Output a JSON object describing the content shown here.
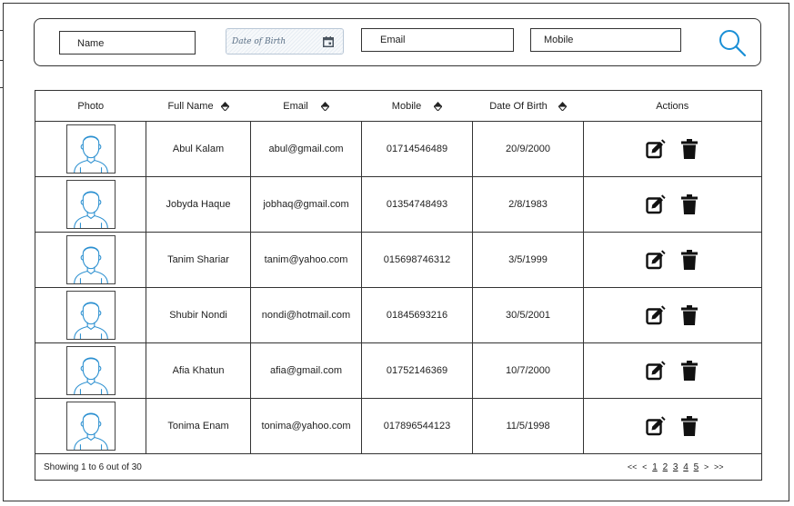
{
  "filters": {
    "name_label": "Name",
    "dob_label": "Date of Birth",
    "email_label": "Email",
    "mobile_label": "Mobile"
  },
  "table": {
    "headers": [
      "Photo",
      "Full Name",
      "Email",
      "Mobile",
      "Date Of Birth",
      "Actions"
    ],
    "rows": [
      {
        "name": "Abul Kalam",
        "email": "abul@gmail.com",
        "mobile": "01714546489",
        "dob": "20/9/2000"
      },
      {
        "name": "Jobyda Haque",
        "email": "jobhaq@gmail.com",
        "mobile": "01354748493",
        "dob": "2/8/1983"
      },
      {
        "name": "Tanim Shariar",
        "email": "tanim@yahoo.com",
        "mobile": "015698746312",
        "dob": "3/5/1999"
      },
      {
        "name": "Shubir Nondi",
        "email": "nondi@hotmail.com",
        "mobile": "01845693216",
        "dob": "30/5/2001"
      },
      {
        "name": "Afia Khatun",
        "email": "afia@gmail.com",
        "mobile": "01752146369",
        "dob": "10/7/2000"
      },
      {
        "name": "Tonima Enam",
        "email": "tonima@yahoo.com",
        "mobile": "017896544123",
        "dob": "11/5/1998"
      }
    ]
  },
  "footer": {
    "showing": "Showing 1 to 6 out of 30",
    "first": "<<",
    "prev": "<",
    "pages": [
      "1",
      "2",
      "3",
      "4",
      "5"
    ],
    "next": ">",
    "last": ">>"
  },
  "icons": {
    "search": "search-icon",
    "calendar": "calendar-icon",
    "sort": "sort-icon",
    "edit": "edit-icon",
    "delete": "delete-icon",
    "avatar": "user-avatar-icon"
  },
  "colors": {
    "accent": "#1a8fd6",
    "avatar_stroke": "#2a8fd0",
    "border": "#333333"
  }
}
